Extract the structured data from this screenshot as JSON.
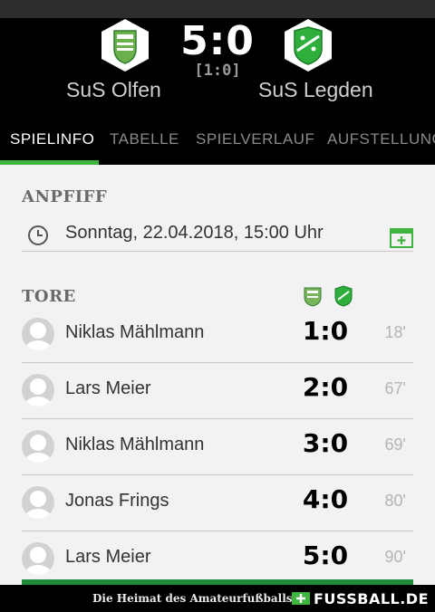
{
  "match": {
    "score": "5:0",
    "halftime": "[1:0]",
    "home_team": "SuS Olfen",
    "away_team": "SuS Legden"
  },
  "tabs": [
    {
      "label": "SPIELINFO",
      "active": true
    },
    {
      "label": "TABELLE",
      "active": false
    },
    {
      "label": "SPIELVERLAUF",
      "active": false
    },
    {
      "label": "AUFSTELLUNG",
      "active": false
    }
  ],
  "kickoff": {
    "title": "ANPFIFF",
    "datetime": "Sonntag, 22.04.2018, 15:00 Uhr"
  },
  "goals": {
    "title": "TORE",
    "rows": [
      {
        "player": "Niklas Mählmann",
        "score": "1:0",
        "minute": "18'"
      },
      {
        "player": "Lars Meier",
        "score": "2:0",
        "minute": "67'"
      },
      {
        "player": "Niklas Mählmann",
        "score": "3:0",
        "minute": "69'"
      },
      {
        "player": "Jonas Frings",
        "score": "4:0",
        "minute": "80'"
      },
      {
        "player": "Lars Meier",
        "score": "5:0",
        "minute": "90'"
      }
    ]
  },
  "footer": {
    "tagline": "Die Heimat des Amateurfußballs",
    "brand": "FUSSBALL.DE"
  },
  "colors": {
    "accent_green": "#3fb43f",
    "crest_green": "#2e8b3a",
    "header_bg": "#000000"
  },
  "icons": {
    "clock": "clock-icon",
    "calendar": "calendar-add-icon",
    "avatar": "player-avatar-icon"
  }
}
